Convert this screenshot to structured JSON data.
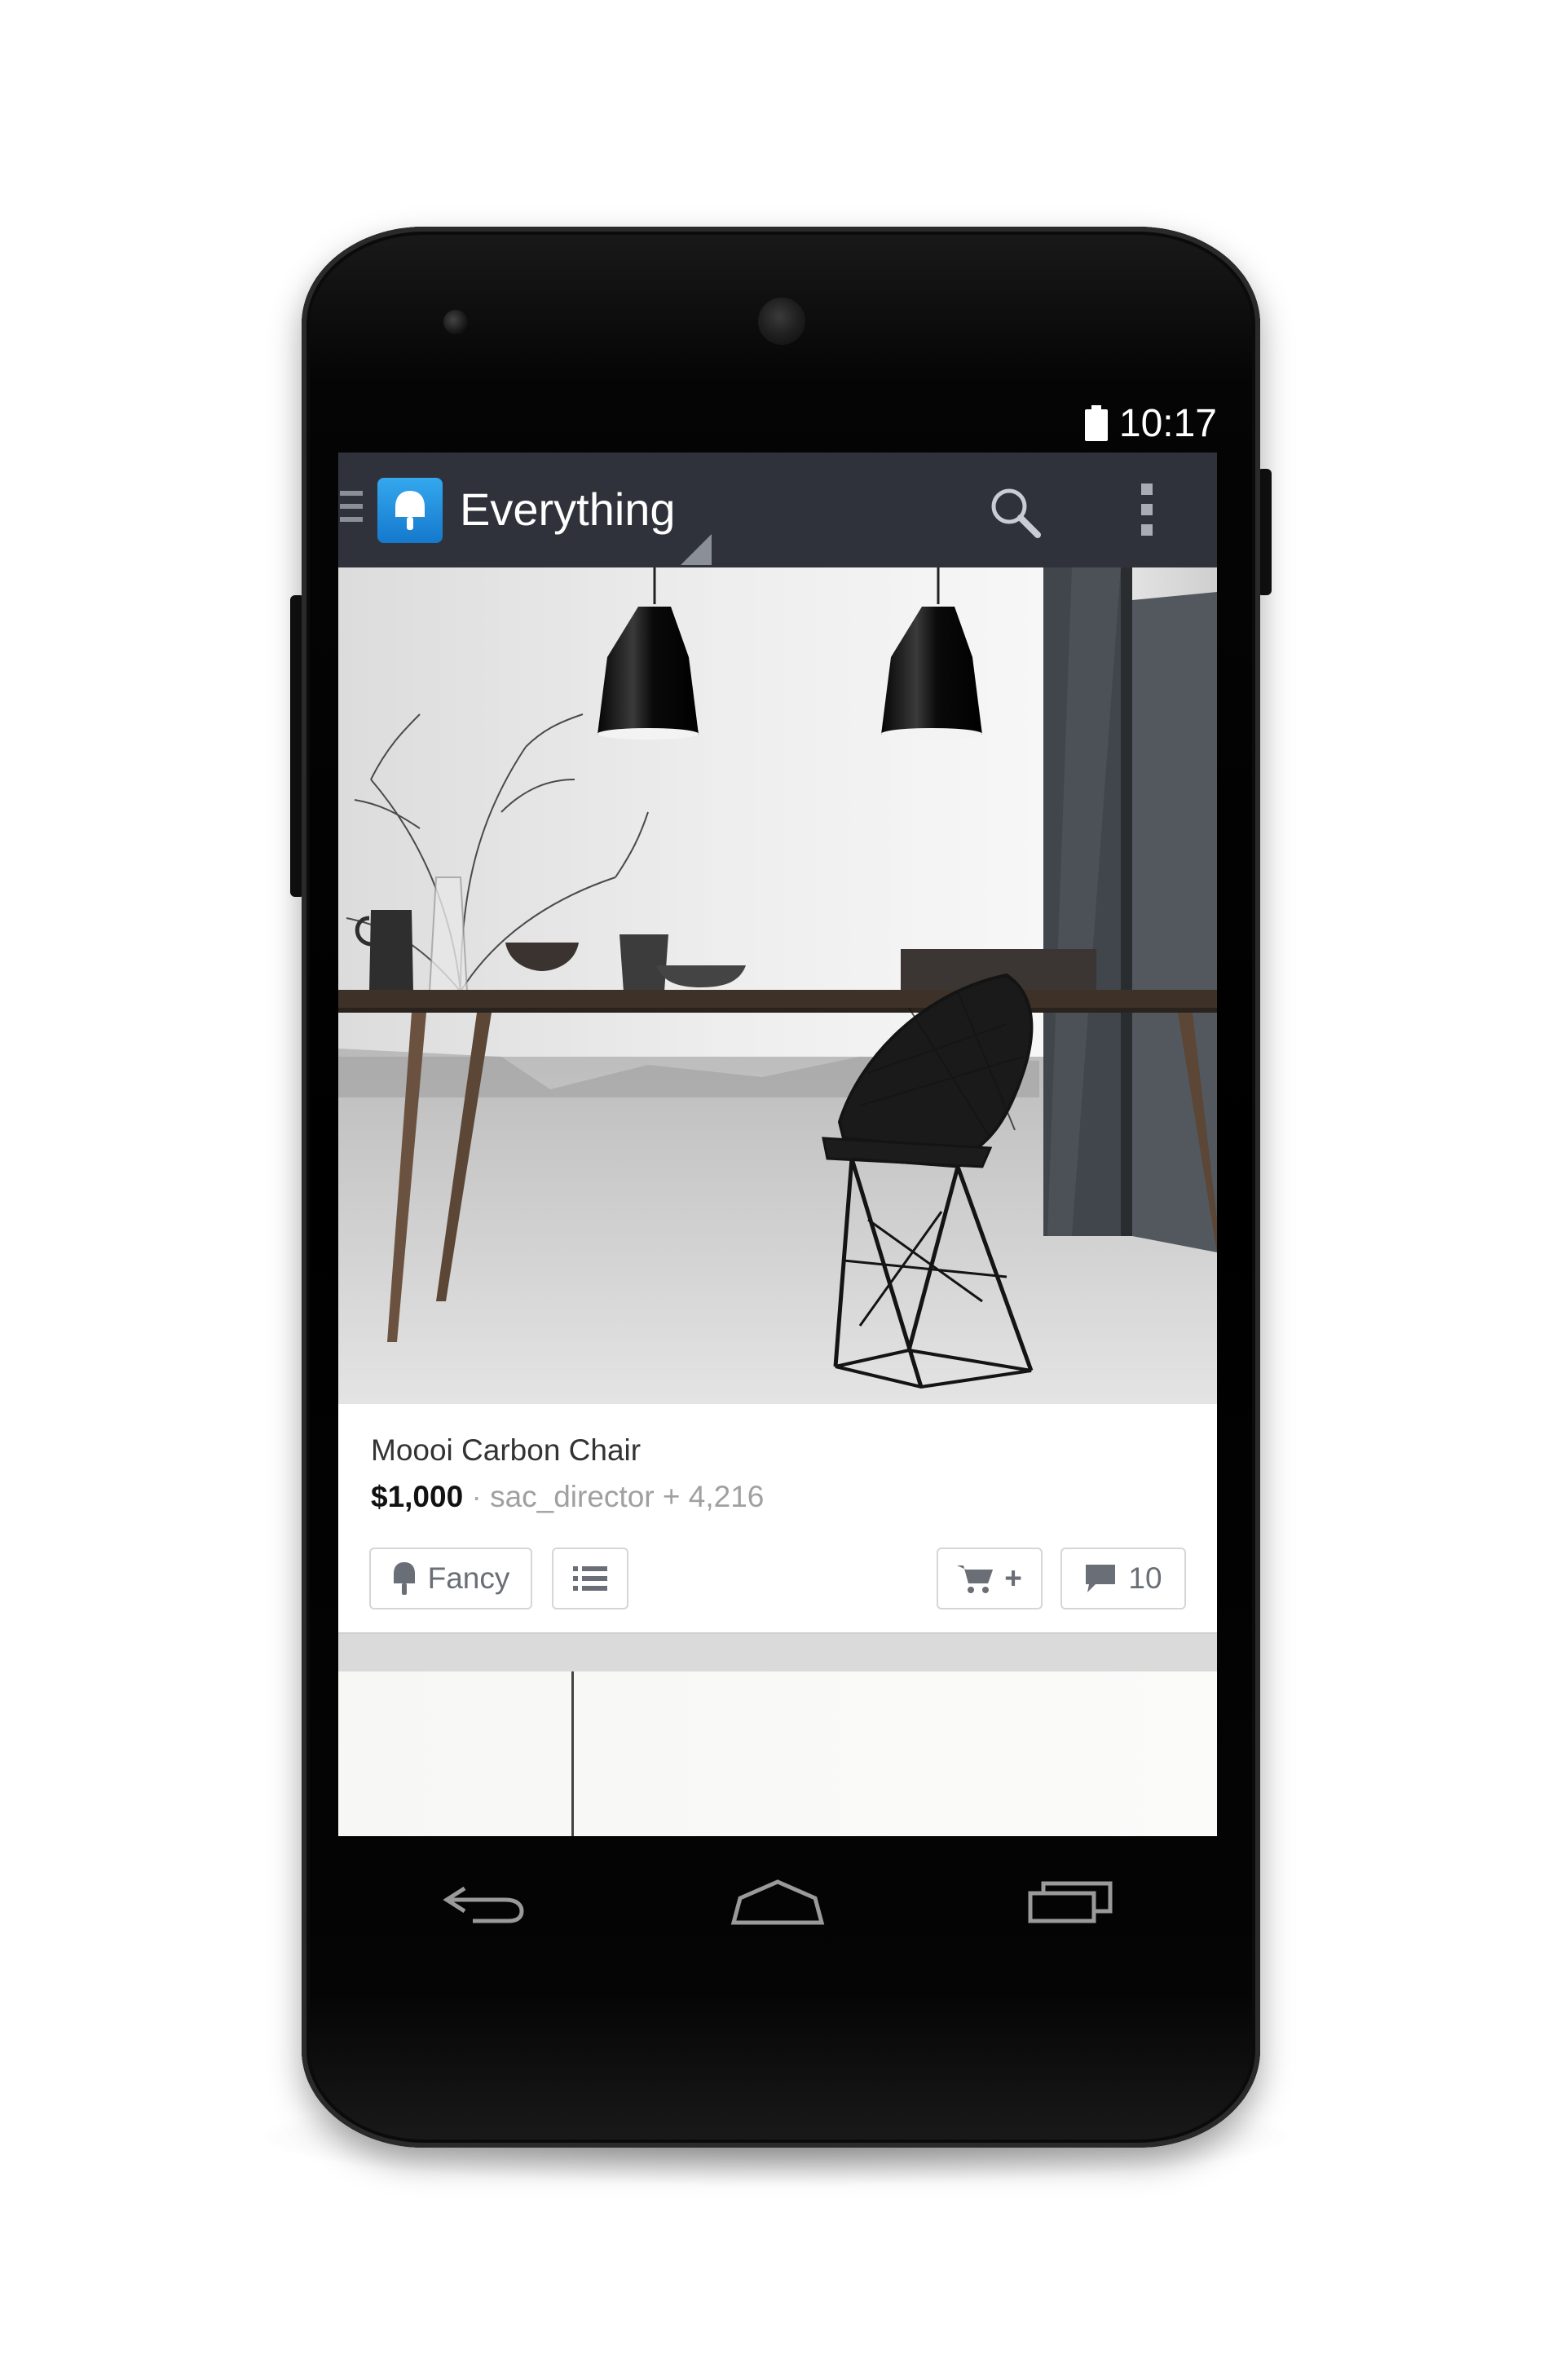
{
  "status_bar": {
    "time": "10:17"
  },
  "action_bar": {
    "title": "Everything",
    "icons": [
      "navigation-drawer-icon",
      "fancy-logo-icon",
      "search-icon",
      "overflow-menu-icon"
    ]
  },
  "feed": {
    "product": {
      "name": "Moooi Carbon Chair",
      "price": "$1,000",
      "separator": "·",
      "byline": "sac_director + 4,216",
      "fancy_label": "Fancy",
      "comment_count": "10",
      "cart_plus": "+"
    }
  },
  "nav_bar": {
    "icons": [
      "back-icon",
      "home-icon",
      "recent-apps-icon"
    ]
  },
  "colors": {
    "action_bar_bg": "#2f323a",
    "logo_blue": "#1d8fe0",
    "button_border": "#d6d6d6",
    "muted_text": "#a0a0a0"
  }
}
